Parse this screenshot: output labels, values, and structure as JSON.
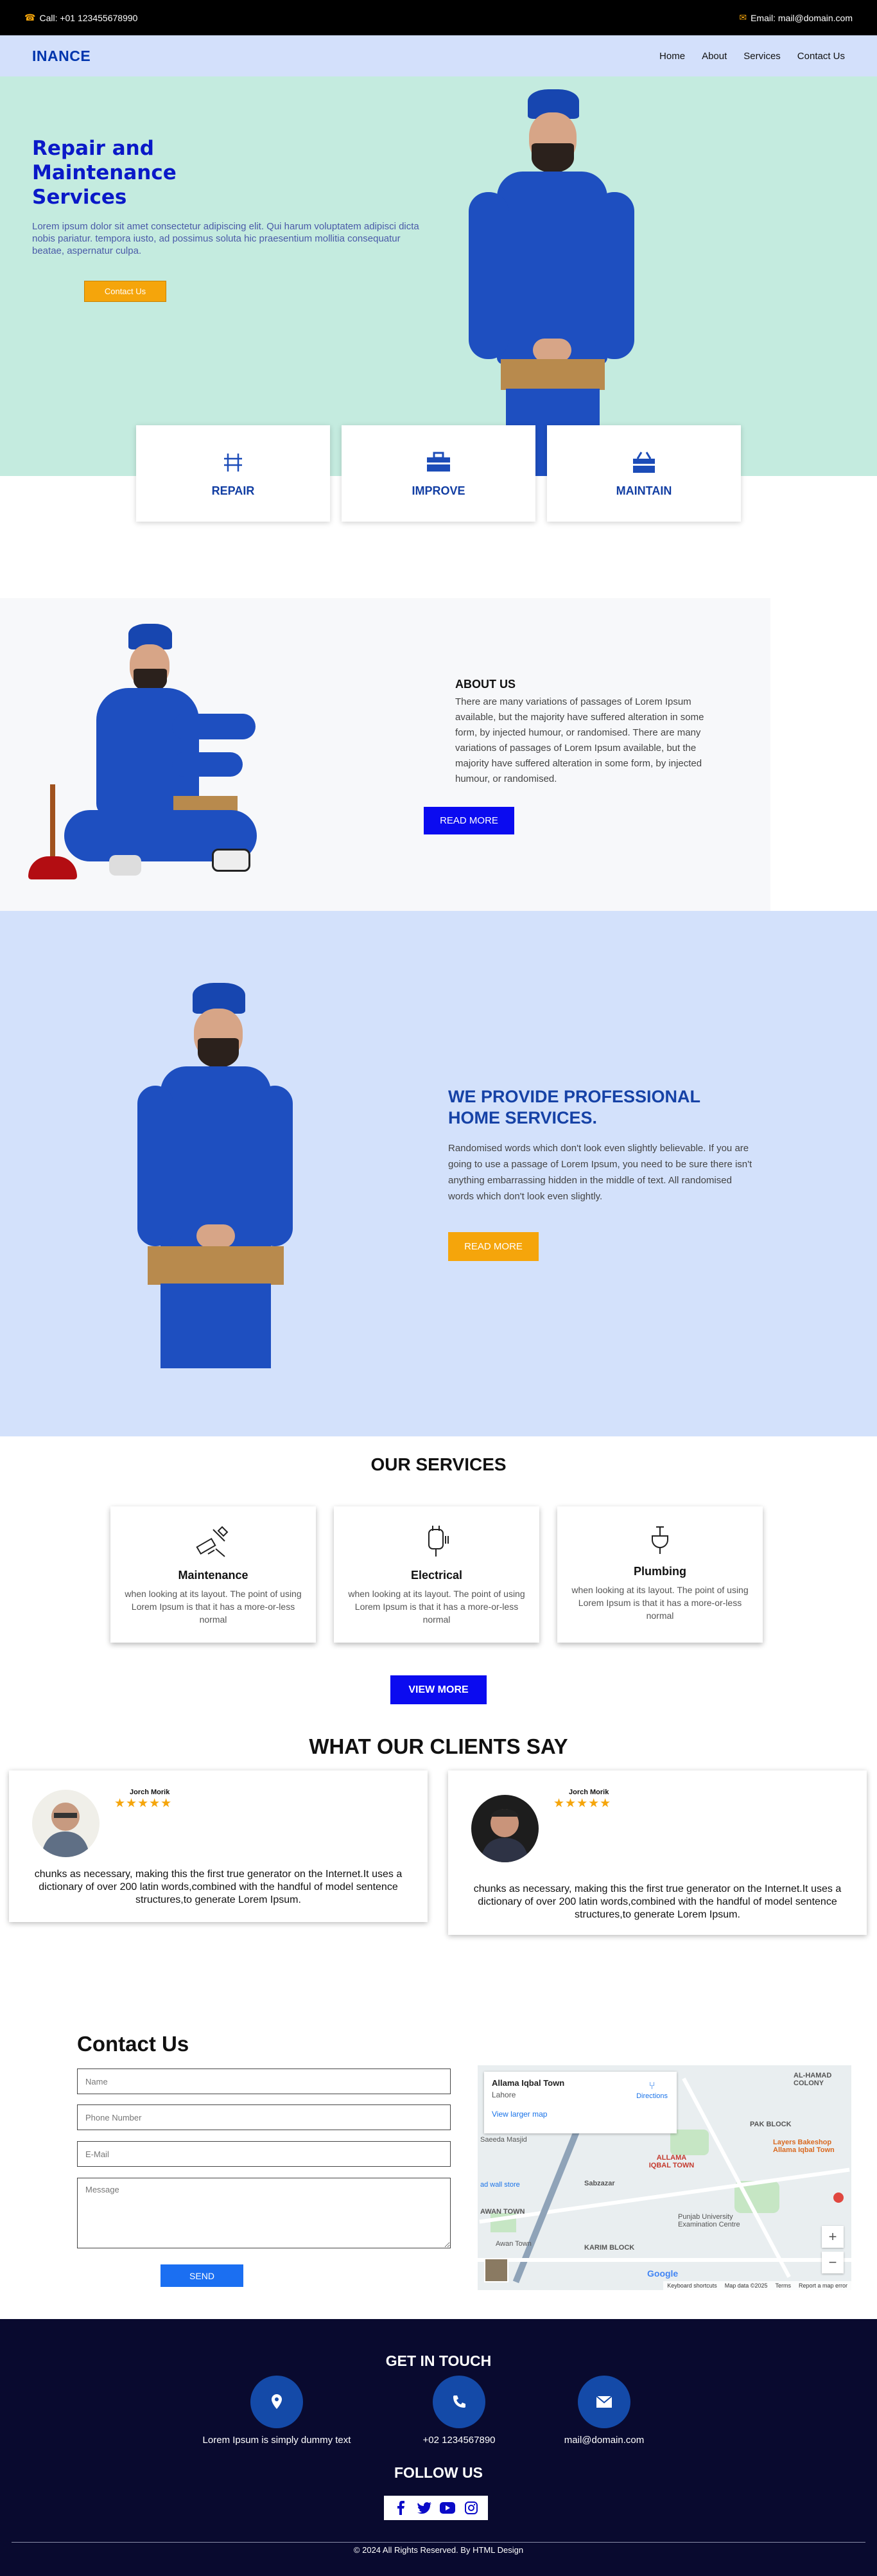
{
  "topbar": {
    "call": "Call: +01 123455678990",
    "email": "Email: mail@domain.com"
  },
  "nav": {
    "brand": "INANCE",
    "items": [
      "Home",
      "About",
      "Services",
      "Contact Us"
    ]
  },
  "hero": {
    "title": "Repair and Maintenance Services",
    "text": "Lorem ipsum dolor sit amet consectetur adipiscing elit. Qui harum voluptatem adipisci dicta nobis pariatur. tempora iusto, ad possimus soluta hic praesentium mollitia consequatur beatae, aspernatur culpa.",
    "cta": "Contact Us"
  },
  "features": [
    {
      "label": "REPAIR",
      "icon": "tools-icon"
    },
    {
      "label": "IMPROVE",
      "icon": "toolbox-icon"
    },
    {
      "label": "MAINTAIN",
      "icon": "toolkit-icon"
    }
  ],
  "about": {
    "title": "ABOUT US",
    "text": "There are many variations of passages of Lorem Ipsum available, but the majority have suffered alteration in some form, by injected humour, or randomised. There are many variations of passages of Lorem Ipsum available, but the majority have suffered alteration in some form, by injected humour, or randomised.",
    "button": "READ MORE"
  },
  "pro": {
    "title": "WE PROVIDE PROFESSIONAL HOME SERVICES.",
    "text": "Randomised words which don't look even slightly believable. If you are going to use a passage of Lorem Ipsum, you need to be sure there isn't anything embarrassing hidden in the middle of text. All randomised words which don't look even slightly.",
    "button": "READ MORE"
  },
  "services": {
    "title": "OUR SERVICES",
    "items": [
      {
        "name": "Maintenance",
        "desc": "when looking at its layout. The point of using Lorem Ipsum is that it has a more-or-less normal"
      },
      {
        "name": "Electrical",
        "desc": "when looking at its layout. The point of using Lorem Ipsum is that it has a more-or-less normal"
      },
      {
        "name": "Plumbing",
        "desc": "when looking at its layout. The point of using Lorem Ipsum is that it has a more-or-less normal"
      }
    ],
    "button": "VIEW MORE"
  },
  "clients": {
    "title": "WHAT OUR CLIENTS SAY",
    "items": [
      {
        "name": "Jorch Morik",
        "stars": "★★★★★",
        "text": "chunks as necessary, making this the first true generator on the Internet.It uses a dictionary of over 200 latin words,combined with the handful of model sentence structures,to generate Lorem Ipsum."
      },
      {
        "name": "Jorch Morik",
        "stars": "★★★★★",
        "text": "chunks as necessary, making this the first true generator on the Internet.It uses a dictionary of over 200 latin words,combined with the handful of model sentence structures,to generate Lorem Ipsum."
      }
    ]
  },
  "contact": {
    "title": "Contact Us",
    "name_placeholder": "Name",
    "phone_placeholder": "Phone Number",
    "email_placeholder": "E-Mail",
    "message_placeholder": "Message",
    "send": "SEND"
  },
  "map": {
    "place": "Allama Iqbal Town",
    "city": "Lahore",
    "directions": "Directions",
    "larger": "View larger map",
    "labels": [
      "AL-HAMAD COLONY",
      "PAK BLOCK",
      "Layers Bakeshop Allama Iqbal Town",
      "ALLAMA IQBAL TOWN",
      "Sabzazar",
      "Punjab University Examination Centre",
      "KARIM BLOCK",
      "AWAN TOWN",
      "Awan Town",
      "Saeeda Masjid",
      "ad wall store"
    ],
    "attribution": [
      "Keyboard shortcuts",
      "Map data ©2025",
      "Terms",
      "Report a map error"
    ],
    "google": "Google"
  },
  "footer": {
    "get_in_touch": "GET IN TOUCH",
    "address": "Lorem Ipsum is simply dummy text",
    "phone": "+02 1234567890",
    "email": "mail@domain.com",
    "follow": "FOLLOW US",
    "copyright": "© 2024 All Rights Reserved. By HTML Design"
  },
  "colors": {
    "accent": "#f5a50b",
    "brand": "#0035ad",
    "button_blue": "#0b0bf0",
    "footer_bg": "#090a2f"
  }
}
